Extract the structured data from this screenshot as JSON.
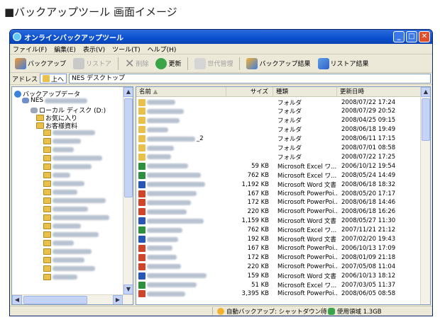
{
  "caption": "■バックアップツール 画面イメージ",
  "window": {
    "title": "オンラインバックアップツール",
    "buttons": [
      "_",
      "□",
      "✕"
    ]
  },
  "menu": [
    "ファイル(F)",
    "編集(E)",
    "表示(V)",
    "ツール(T)",
    "ヘルプ(H)"
  ],
  "toolbar": {
    "backup": "バックアップ",
    "restore": "リストア",
    "delete": "削除",
    "refresh": "更新",
    "generation": "世代管理",
    "backup_result": "バックアップ結果",
    "restore_result": "リストア結果"
  },
  "address": {
    "label": "アドレス",
    "up": "上へ",
    "value": "NES                 デスクトップ"
  },
  "tree": {
    "root": "バックアップデータ",
    "node1": "NES",
    "local_disk": "ローカル ディスク (D:)",
    "favorites": "お気に入り",
    "customer": "お客様資料"
  },
  "list": {
    "columns": [
      "名前",
      "サイズ",
      "種類",
      "更新日時"
    ],
    "sort_indicator": "▲",
    "rows": [
      {
        "size": "",
        "type": "フォルダ",
        "date": "2008/07/22 17:24",
        "icon": "folder"
      },
      {
        "size": "",
        "type": "フォルダ",
        "date": "2008/07/29 20:52",
        "icon": "folder"
      },
      {
        "size": "",
        "type": "フォルダ",
        "date": "2008/04/25 09:15",
        "icon": "folder"
      },
      {
        "size": "",
        "type": "フォルダ",
        "date": "2008/06/18 19:49",
        "icon": "folder"
      },
      {
        "size": "",
        "type": "フォルダ",
        "date": "2008/06/11 17:15",
        "icon": "folder",
        "suffix": "_2"
      },
      {
        "size": "",
        "type": "フォルダ",
        "date": "2008/07/01 08:58",
        "icon": "folder"
      },
      {
        "size": "",
        "type": "フォルダ",
        "date": "2008/07/22 17:25",
        "icon": "folder"
      },
      {
        "size": "59 KB",
        "type": "Microsoft Excel ワ...",
        "date": "2006/10/12 19:54",
        "icon": "excel"
      },
      {
        "size": "762 KB",
        "type": "Microsoft Excel ワ...",
        "date": "2008/05/24 14:49",
        "icon": "excel"
      },
      {
        "size": "1,192 KB",
        "type": "Microsoft Word 文書",
        "date": "2008/06/18 18:32",
        "icon": "word"
      },
      {
        "size": "167 KB",
        "type": "Microsoft PowerPoi...",
        "date": "2008/05/20 17:17",
        "icon": "ppt"
      },
      {
        "size": "172 KB",
        "type": "Microsoft PowerPoi...",
        "date": "2008/06/18 14:46",
        "icon": "ppt"
      },
      {
        "size": "220 KB",
        "type": "Microsoft PowerPoi...",
        "date": "2008/06/18 16:26",
        "icon": "ppt"
      },
      {
        "size": "1,159 KB",
        "type": "Microsoft Word 文書",
        "date": "2008/05/27 11:30",
        "icon": "word"
      },
      {
        "size": "762 KB",
        "type": "Microsoft Excel ワ...",
        "date": "2007/11/21 21:12",
        "icon": "excel"
      },
      {
        "size": "192 KB",
        "type": "Microsoft Word 文書",
        "date": "2007/02/20 19:43",
        "icon": "word"
      },
      {
        "size": "167 KB",
        "type": "Microsoft PowerPoi...",
        "date": "2006/10/13 17:09",
        "icon": "ppt"
      },
      {
        "size": "172 KB",
        "type": "Microsoft PowerPoi...",
        "date": "2008/01/09 21:18",
        "icon": "ppt"
      },
      {
        "size": "220 KB",
        "type": "Microsoft PowerPoi...",
        "date": "2007/05/08 11:04",
        "icon": "ppt"
      },
      {
        "size": "159 KB",
        "type": "Microsoft Word 文書",
        "date": "2006/10/13 18:12",
        "icon": "word"
      },
      {
        "size": "51 KB",
        "type": "Microsoft Excel ワ...",
        "date": "2007/03/05 11:37",
        "icon": "excel"
      },
      {
        "size": "3,395 KB",
        "type": "Microsoft PowerPoi...",
        "date": "2008/06/05 08:58",
        "icon": "ppt"
      }
    ]
  },
  "status": {
    "auto_backup": "自動バックアップ: シャットダウン時",
    "usage": "使用領域 1.3GB"
  },
  "colors": {
    "folder": "#e8c04a",
    "excel": "#2f8f3f",
    "word": "#2a55b8",
    "ppt": "#d0442a"
  }
}
